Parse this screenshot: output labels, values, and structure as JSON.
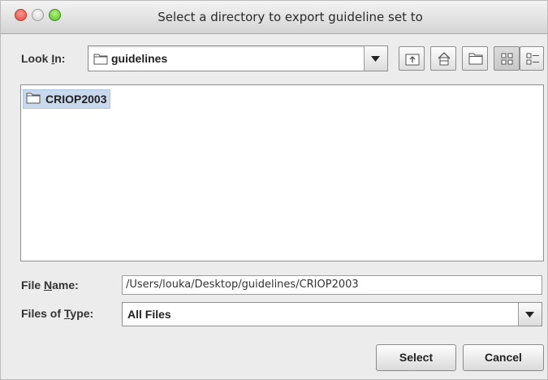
{
  "window": {
    "title": "Select a directory to export guideline set to"
  },
  "lookin": {
    "label_pre": "Look ",
    "label_u": "I",
    "label_post": "n:",
    "value": "guidelines"
  },
  "toolbar": {
    "icons": [
      "up-one-level-icon",
      "home-icon",
      "new-folder-icon",
      "list-view-icon",
      "details-view-icon"
    ]
  },
  "files": [
    {
      "name": "CRIOP2003",
      "selected": true
    }
  ],
  "filename": {
    "label_pre": "File ",
    "label_u": "N",
    "label_post": "ame:",
    "value": "/Users/louka/Desktop/guidelines/CRIOP2003"
  },
  "filetype": {
    "label_pre": "Files of ",
    "label_u": "T",
    "label_post": "ype:",
    "value": "All Files"
  },
  "buttons": {
    "select": "Select",
    "cancel": "Cancel"
  }
}
